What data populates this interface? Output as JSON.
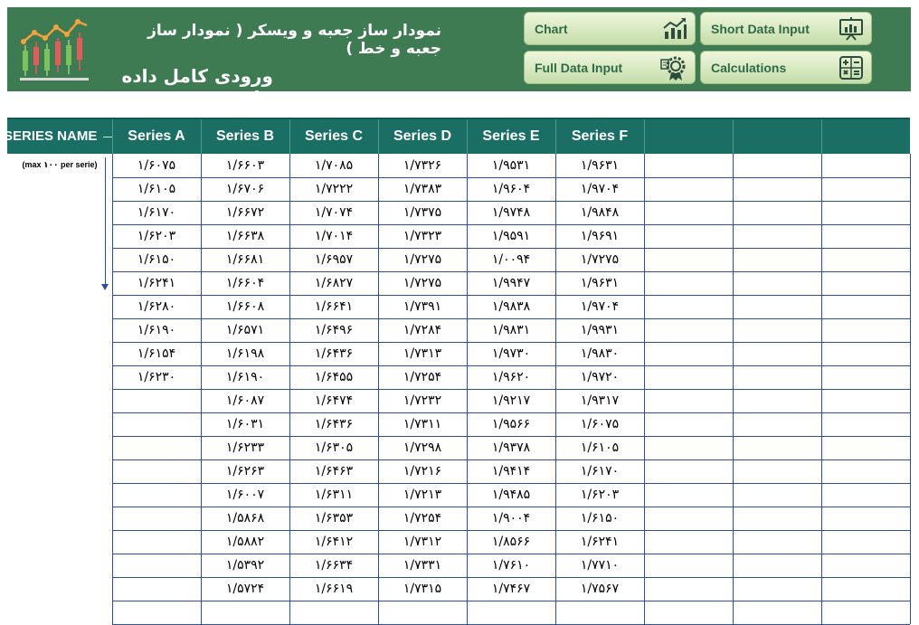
{
  "header": {
    "title_main": "نمودار ساز جعبه و ویسکر ( نمودار ساز جعبه و خط )",
    "title_sub": "ورودی کامل داده ها",
    "logo_icon": "candlestick-chart-icon"
  },
  "nav": {
    "chart": {
      "label": "Chart",
      "icon": "line-chart-icon"
    },
    "short_data_input": {
      "label": "Short Data Input",
      "icon": "presentation-board-icon"
    },
    "full_data_input": {
      "label": "Full Data Input",
      "icon": "gear-certificate-icon"
    },
    "calculations": {
      "label": "Calculations",
      "icon": "calculator-icon"
    }
  },
  "table": {
    "series_name_header": "SERIES NAME",
    "note": "(max ۱۰۰ per serie)",
    "columns": [
      "Series A",
      "Series B",
      "Series C",
      "Series D",
      "Series E",
      "Series F",
      "",
      "",
      ""
    ],
    "rows": [
      [
        "۱/۶۰۷۵",
        "۱/۶۶۰۳",
        "۱/۷۰۸۵",
        "۱/۷۳۲۶",
        "۱/۹۵۳۱",
        "۱/۹۶۳۱"
      ],
      [
        "۱/۶۱۰۵",
        "۱/۶۷۰۶",
        "۱/۷۲۲۲",
        "۱/۷۳۸۳",
        "۱/۹۶۰۴",
        "۱/۹۷۰۴"
      ],
      [
        "۱/۶۱۷۰",
        "۱/۶۶۷۲",
        "۱/۷۰۷۴",
        "۱/۷۳۷۵",
        "۱/۹۷۴۸",
        "۱/۹۸۴۸"
      ],
      [
        "۱/۶۲۰۳",
        "۱/۶۶۳۸",
        "۱/۷۰۱۴",
        "۱/۷۳۲۳",
        "۱/۹۵۹۱",
        "۱/۹۶۹۱"
      ],
      [
        "۱/۶۱۵۰",
        "۱/۶۶۸۱",
        "۱/۶۹۵۷",
        "۱/۷۲۷۵",
        "۱/۰۰۹۴",
        "۱/۷۲۷۵"
      ],
      [
        "۱/۶۲۴۱",
        "۱/۶۶۰۴",
        "۱/۶۸۲۷",
        "۱/۷۲۷۵",
        "۱/۹۹۴۷",
        "۱/۹۶۳۱"
      ],
      [
        "۱/۶۲۸۰",
        "۱/۶۶۰۸",
        "۱/۶۶۴۱",
        "۱/۷۳۹۱",
        "۱/۹۸۳۸",
        "۱/۹۷۰۴"
      ],
      [
        "۱/۶۱۹۰",
        "۱/۶۵۷۱",
        "۱/۶۴۹۶",
        "۱/۷۲۸۴",
        "۱/۹۸۳۱",
        "۱/۹۹۳۱"
      ],
      [
        "۱/۶۱۵۴",
        "۱/۶۱۹۸",
        "۱/۶۴۳۶",
        "۱/۷۳۱۳",
        "۱/۹۷۳۰",
        "۱/۹۸۳۰"
      ],
      [
        "۱/۶۲۳۰",
        "۱/۶۱۹۰",
        "۱/۶۴۵۵",
        "۱/۷۲۵۴",
        "۱/۹۶۲۰",
        "۱/۹۷۲۰"
      ],
      [
        "",
        "۱/۶۰۸۷",
        "۱/۶۴۷۴",
        "۱/۷۲۳۲",
        "۱/۹۲۱۷",
        "۱/۹۳۱۷"
      ],
      [
        "",
        "۱/۶۰۳۱",
        "۱/۶۴۳۶",
        "۱/۷۳۱۱",
        "۱/۹۵۶۶",
        "۱/۶۰۷۵"
      ],
      [
        "",
        "۱/۶۲۳۳",
        "۱/۶۳۰۵",
        "۱/۷۲۹۸",
        "۱/۹۳۷۸",
        "۱/۶۱۰۵"
      ],
      [
        "",
        "۱/۶۲۶۳",
        "۱/۶۴۶۳",
        "۱/۷۲۱۶",
        "۱/۹۴۱۴",
        "۱/۶۱۷۰"
      ],
      [
        "",
        "۱/۶۰۰۷",
        "۱/۶۳۱۱",
        "۱/۷۲۱۳",
        "۱/۹۴۸۵",
        "۱/۶۲۰۳"
      ],
      [
        "",
        "۱/۵۸۶۸",
        "۱/۶۳۵۳",
        "۱/۷۲۵۴",
        "۱/۹۰۰۴",
        "۱/۶۱۵۰"
      ],
      [
        "",
        "۱/۵۸۸۲",
        "۱/۶۴۱۲",
        "۱/۷۳۱۲",
        "۱/۸۵۶۶",
        "۱/۶۲۴۱"
      ],
      [
        "",
        "۱/۵۳۹۲",
        "۱/۶۶۳۴",
        "۱/۷۳۳۱",
        "۱/۷۶۱۰",
        "۱/۷۷۱۰"
      ],
      [
        "",
        "۱/۵۷۲۴",
        "۱/۶۶۱۹",
        "۱/۷۳۱۵",
        "۱/۷۴۶۷",
        "۱/۷۵۶۷"
      ],
      [
        "",
        "",
        "",
        "",
        "",
        ""
      ]
    ]
  },
  "colors": {
    "header_bg": "#3e7a52",
    "table_header_bg": "#1a6e63",
    "grid_line": "#2e4f9a",
    "button_text": "#2f6b46"
  }
}
